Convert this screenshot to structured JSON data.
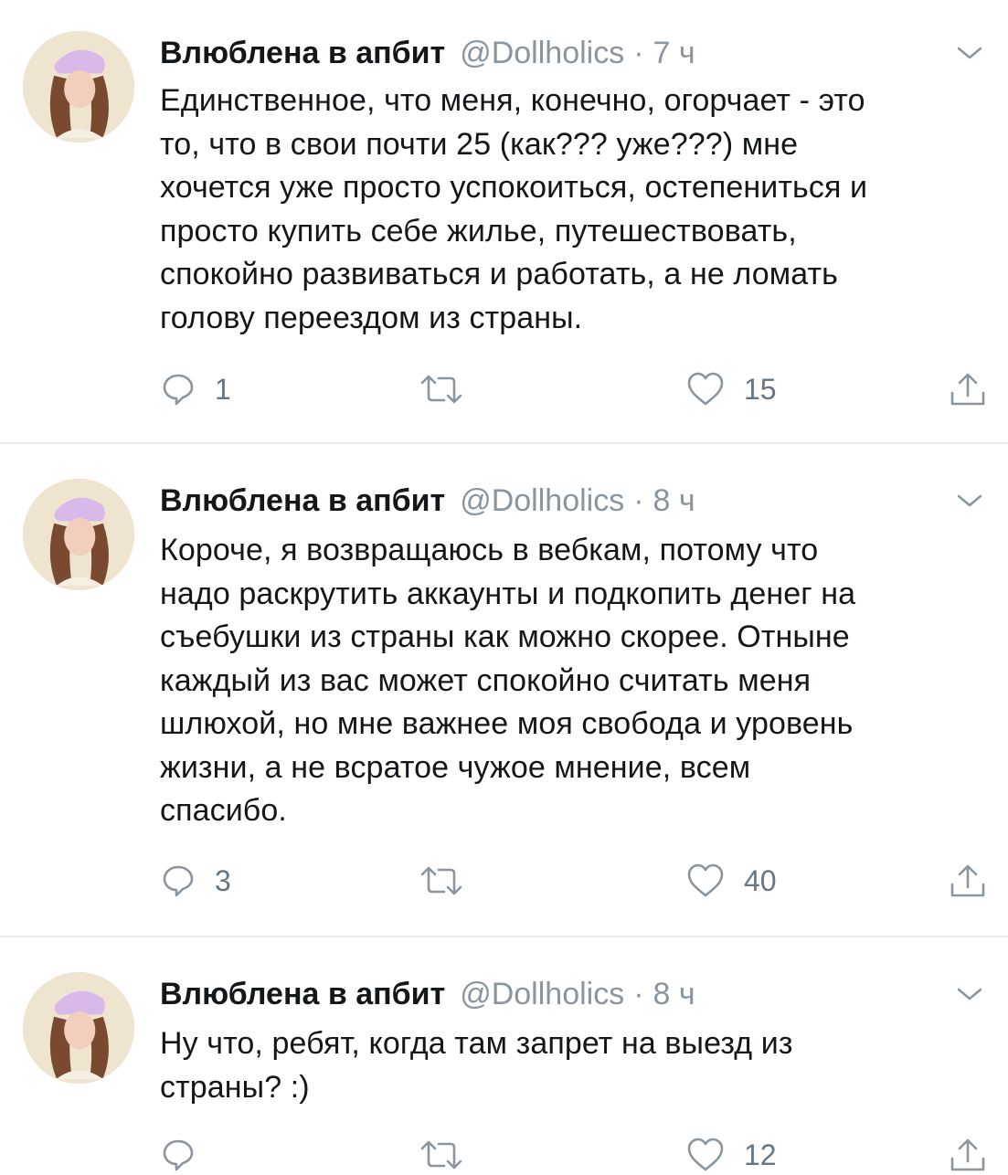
{
  "colors": {
    "text": "#14171a",
    "muted": "#8a959e",
    "icon": "#8a959e",
    "divider": "#e6ecf0"
  },
  "icons": {
    "reply": "reply-icon",
    "retweet": "retweet-icon",
    "like": "heart-icon",
    "share": "share-icon",
    "menu": "chevron-down-icon"
  },
  "tweets": [
    {
      "name": "Влюблена в апбит",
      "handle": "@Dollholics",
      "dot": "·",
      "time": "7 ч",
      "lines": [
        "Единственное, что меня,  конечно, огорчает - это",
        "то, что в свои почти 25 (как??? уже???) мне",
        "хочется уже просто успокоиться,  остепениться и",
        "просто купить себе жилье,  путешествовать,",
        "спокойно развиваться и работать, а не ломать",
        "голову переездом из страны."
      ],
      "replies": "1",
      "retweets": "",
      "likes": "15"
    },
    {
      "name": "Влюблена в апбит",
      "handle": "@Dollholics",
      "dot": "·",
      "time": "8 ч",
      "lines": [
        "Короче, я возвращаюсь в вебкам, потому что",
        "надо раскрутить аккаунты и подкопить денег на",
        "съебушки из страны как можно скорее. Отныне",
        "каждый из вас может спокойно считать меня",
        "шлюхой, но мне важнее моя свобода и уровень",
        "жизни, а не всратое чужое мнение, всем",
        "спасибо."
      ],
      "replies": "3",
      "retweets": "",
      "likes": "40"
    },
    {
      "name": "Влюблена в апбит",
      "handle": "@Dollholics",
      "dot": "·",
      "time": "8 ч",
      "lines": [
        "Ну что, ребят, когда там запрет на выезд из",
        "страны? :)"
      ],
      "replies": "",
      "retweets": "",
      "likes": "12"
    }
  ]
}
